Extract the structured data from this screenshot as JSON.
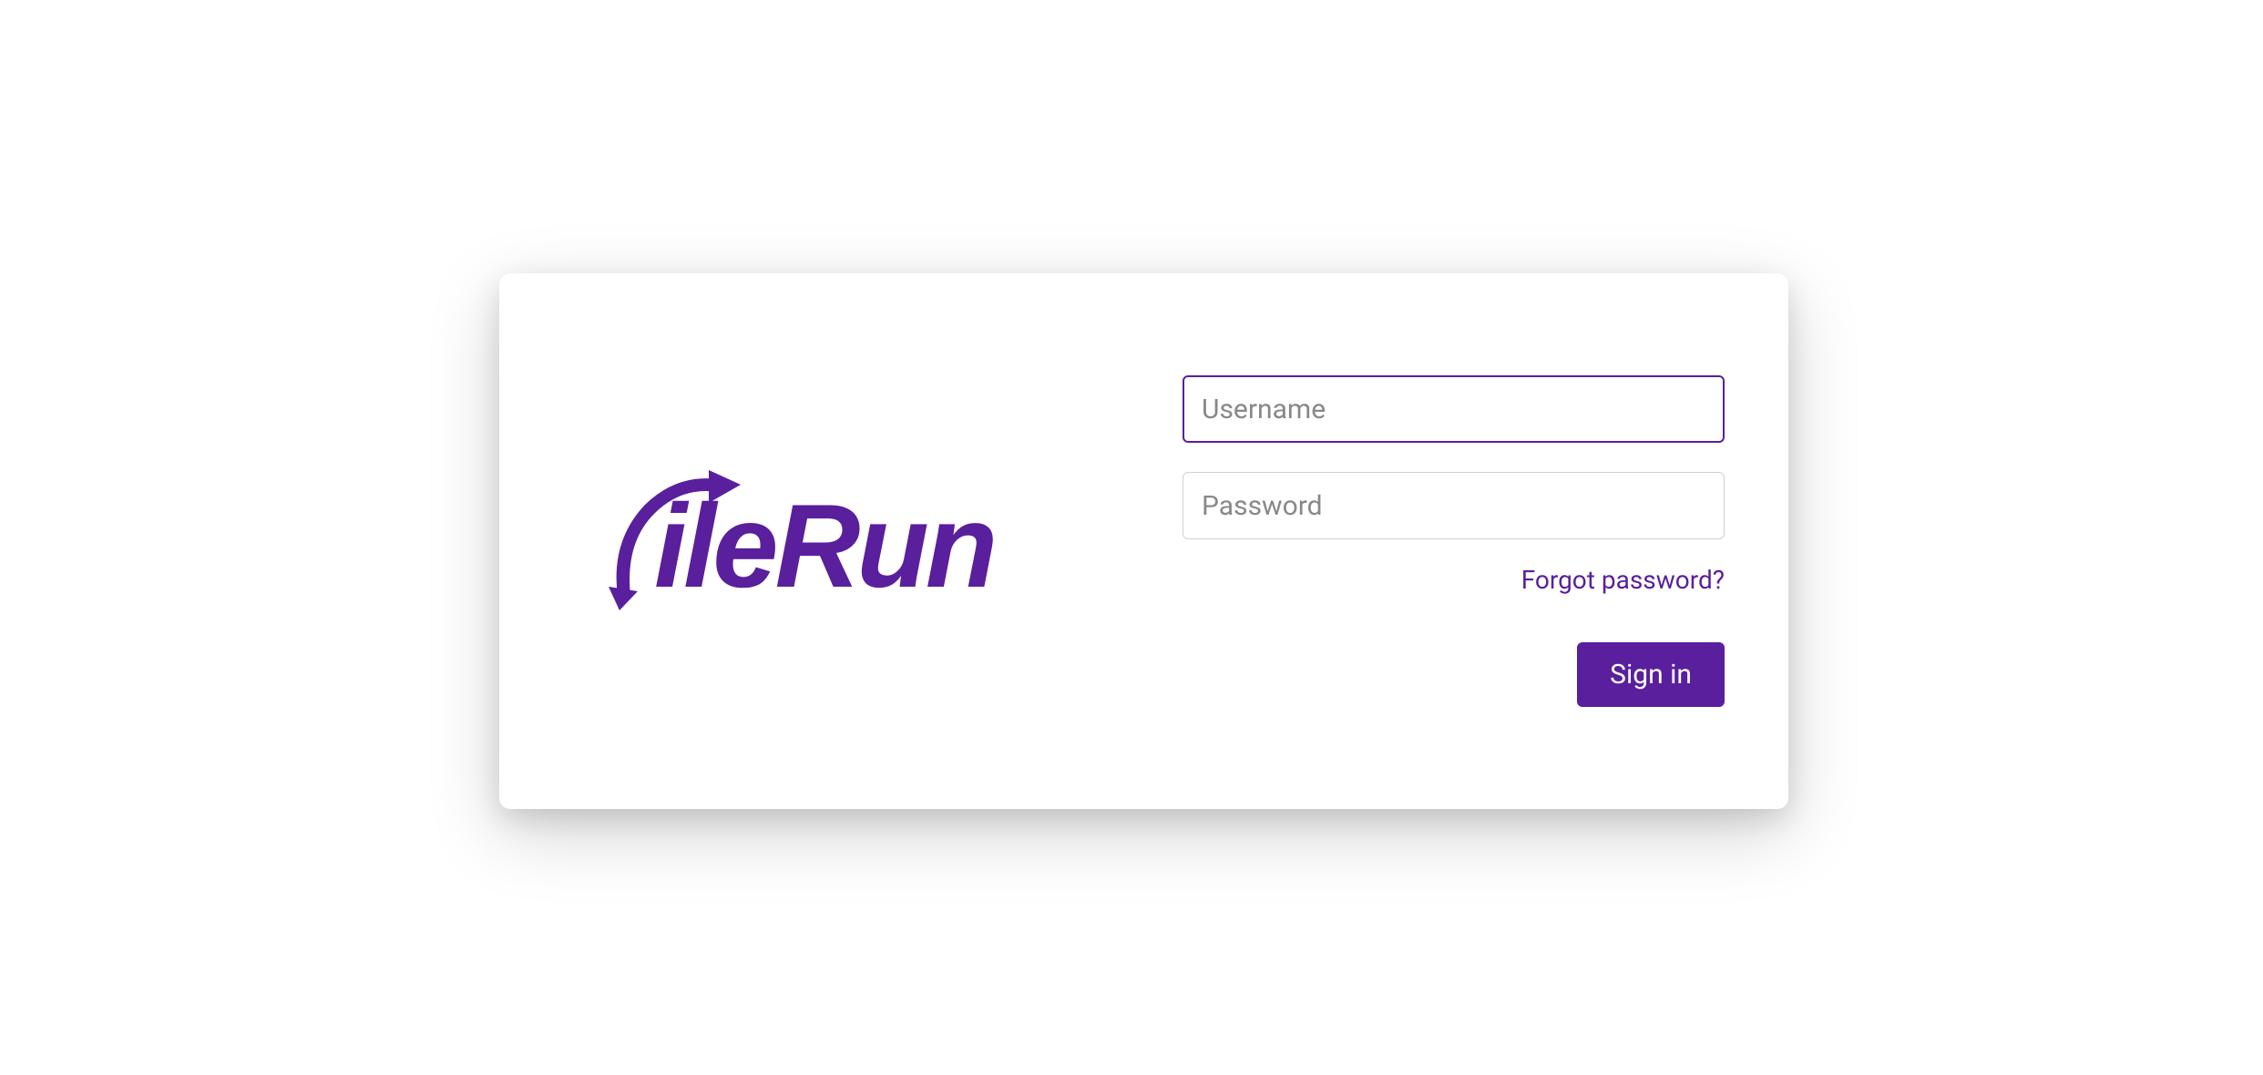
{
  "brand": {
    "name": "FileRun",
    "accent_color": "#5a1f9c"
  },
  "form": {
    "username_placeholder": "Username",
    "username_value": "",
    "password_placeholder": "Password",
    "password_value": "",
    "forgot_password_label": "Forgot password?",
    "signin_label": "Sign in"
  }
}
